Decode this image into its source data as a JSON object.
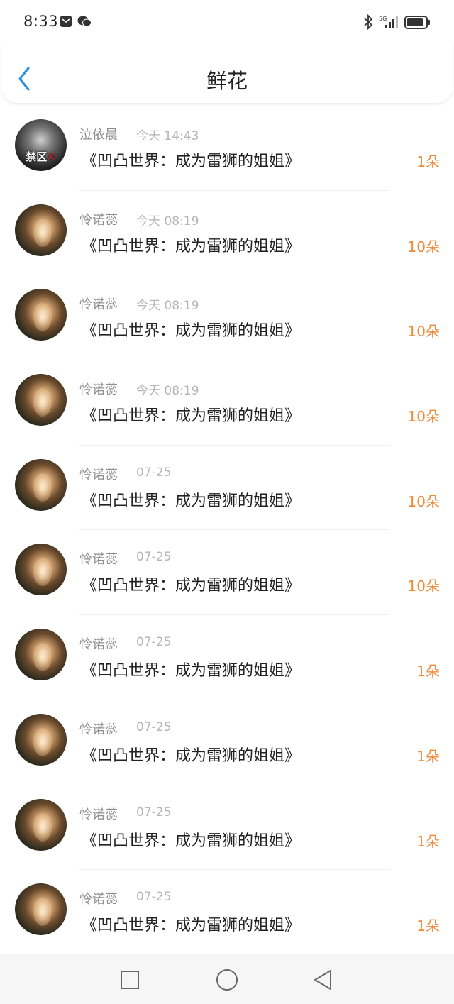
{
  "status": {
    "time": "8:33"
  },
  "header": {
    "title": "鲜花"
  },
  "rows": [
    {
      "name": "泣依晨",
      "time": "今天 14:43",
      "book": "《凹凸世界：成为雷狮的姐姐》",
      "count": "1朵",
      "avatar": "dark",
      "avatar_tag": "禁区"
    },
    {
      "name": "怜诺蕊",
      "time": "今天 08:19",
      "book": "《凹凸世界：成为雷狮的姐姐》",
      "count": "10朵",
      "avatar": "brown"
    },
    {
      "name": "怜诺蕊",
      "time": "今天 08:19",
      "book": "《凹凸世界：成为雷狮的姐姐》",
      "count": "10朵",
      "avatar": "brown"
    },
    {
      "name": "怜诺蕊",
      "time": "今天 08:19",
      "book": "《凹凸世界：成为雷狮的姐姐》",
      "count": "10朵",
      "avatar": "brown"
    },
    {
      "name": "怜诺蕊",
      "time": "07-25",
      "book": "《凹凸世界：成为雷狮的姐姐》",
      "count": "10朵",
      "avatar": "brown"
    },
    {
      "name": "怜诺蕊",
      "time": "07-25",
      "book": "《凹凸世界：成为雷狮的姐姐》",
      "count": "10朵",
      "avatar": "brown"
    },
    {
      "name": "怜诺蕊",
      "time": "07-25",
      "book": "《凹凸世界：成为雷狮的姐姐》",
      "count": "1朵",
      "avatar": "brown"
    },
    {
      "name": "怜诺蕊",
      "time": "07-25",
      "book": "《凹凸世界：成为雷狮的姐姐》",
      "count": "1朵",
      "avatar": "brown"
    },
    {
      "name": "怜诺蕊",
      "time": "07-25",
      "book": "《凹凸世界：成为雷狮的姐姐》",
      "count": "1朵",
      "avatar": "brown"
    },
    {
      "name": "怜诺蕊",
      "time": "07-25",
      "book": "《凹凸世界：成为雷狮的姐姐》",
      "count": "1朵",
      "avatar": "brown"
    }
  ],
  "colors": {
    "accent": "#ee8b3a",
    "back": "#2f8fe0"
  },
  "icons": {
    "back": "chevron-left-icon",
    "home": "square-icon",
    "circle": "circle-icon",
    "triangle": "triangle-back-icon"
  }
}
